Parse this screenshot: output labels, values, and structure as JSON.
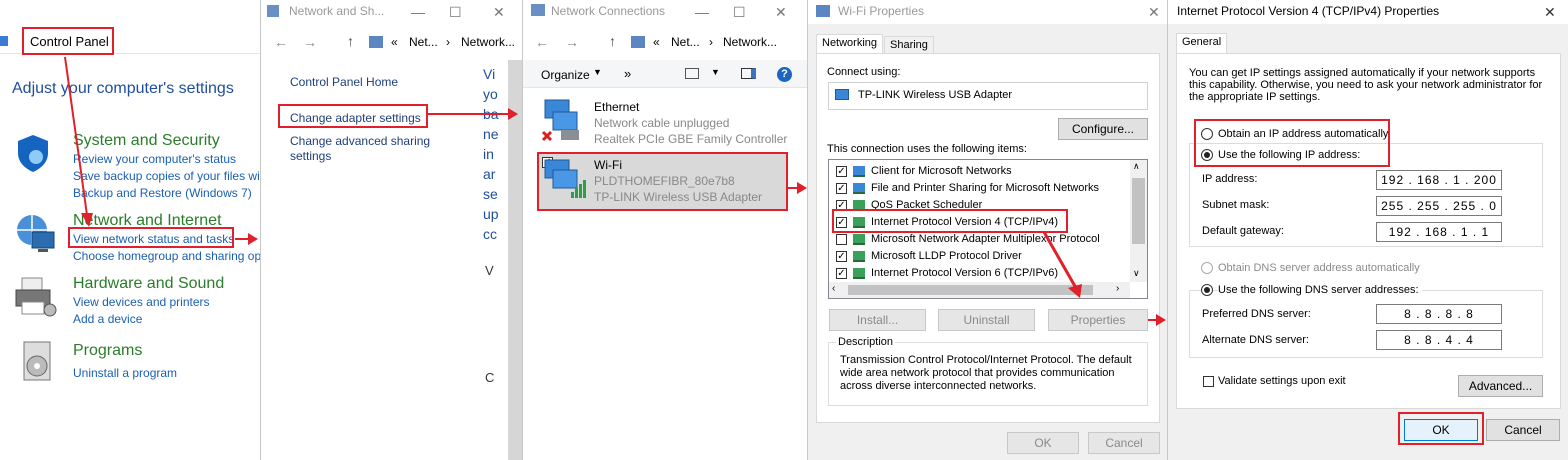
{
  "cp": {
    "breadcrumb": "Control Panel",
    "heading": "Adjust your computer's settings",
    "categories": [
      {
        "title": "System and Security",
        "links": [
          "Review your computer's status",
          "Save backup copies of your files wit",
          "Backup and Restore (Windows 7)"
        ]
      },
      {
        "title": "Network and Internet",
        "links": [
          "View network status and tasks",
          "Choose homegroup and sharing op"
        ]
      },
      {
        "title": "Hardware and Sound",
        "links": [
          "View devices and printers",
          "Add a device"
        ]
      },
      {
        "title": "Programs",
        "links": [
          "Uninstall a program"
        ]
      }
    ]
  },
  "nsc": {
    "title": "Network and Sh...",
    "path": [
      "«",
      "Net...",
      "›",
      "Network..."
    ],
    "links": [
      "Control Panel Home",
      "Change adapter settings",
      "Change advanced sharing",
      "settings"
    ],
    "clipped": [
      "Vi",
      "yo",
      "ba",
      "ne",
      "in",
      "ar",
      "se",
      "up",
      "cc",
      "V",
      "C"
    ]
  },
  "nc": {
    "title": "Network Connections",
    "path": [
      "«",
      "Net...",
      "›",
      "Network..."
    ],
    "organize": "Organize",
    "more": "»",
    "adapters": [
      {
        "name": "Ethernet",
        "status": "Network cable unplugged",
        "device": "Realtek PCIe GBE Family Controller"
      },
      {
        "name": "Wi-Fi",
        "status": "PLDTHOMEFIBR_80e7b8",
        "device": "TP-LINK Wireless USB Adapter"
      }
    ]
  },
  "wifi": {
    "title": "Wi-Fi Properties",
    "tabs": [
      "Networking",
      "Sharing"
    ],
    "connect_using": "Connect using:",
    "adapter": "TP-LINK Wireless USB Adapter",
    "configure": "Configure...",
    "items_label": "This connection uses the following items:",
    "items": [
      {
        "label": "Client for Microsoft Networks",
        "checked": true
      },
      {
        "label": "File and Printer Sharing for Microsoft Networks",
        "checked": true
      },
      {
        "label": "QoS Packet Scheduler",
        "checked": true
      },
      {
        "label": "Internet Protocol Version 4 (TCP/IPv4)",
        "checked": true
      },
      {
        "label": "Microsoft Network Adapter Multiplexor Protocol",
        "checked": false
      },
      {
        "label": "Microsoft LLDP Protocol Driver",
        "checked": true
      },
      {
        "label": "Internet Protocol Version 6 (TCP/IPv6)",
        "checked": true
      }
    ],
    "install": "Install...",
    "uninstall": "Uninstall",
    "properties": "Properties",
    "desc_label": "Description",
    "desc": "Transmission Control Protocol/Internet Protocol. The default wide area network protocol that provides communication across diverse interconnected networks.",
    "ok": "OK",
    "cancel": "Cancel"
  },
  "ipv4": {
    "title": "Internet Protocol Version 4 (TCP/IPv4) Properties",
    "tab": "General",
    "intro": "You can get IP settings assigned automatically if your network supports this capability. Otherwise, you need to ask your network administrator for the appropriate IP settings.",
    "auto_ip": "Obtain an IP address automatically",
    "use_ip": "Use the following IP address:",
    "ip_label": "IP address:",
    "ip": "192 . 168 .  1  . 200",
    "mask_label": "Subnet mask:",
    "mask": "255 . 255 . 255 .  0",
    "gw_label": "Default gateway:",
    "gw": "192 . 168 .  1  .  1",
    "auto_dns": "Obtain DNS server address automatically",
    "use_dns": "Use the following DNS server addresses:",
    "pref_label": "Preferred DNS server:",
    "pref": "8  .  8  .  8  .  8",
    "alt_label": "Alternate DNS server:",
    "alt": "8  .  8  .  4  .  4",
    "validate": "Validate settings upon exit",
    "advanced": "Advanced...",
    "ok": "OK",
    "cancel": "Cancel"
  },
  "colors": {
    "accent_red": "#e0202a",
    "link": "#1a5fb4",
    "category": "#2a7d2a"
  }
}
